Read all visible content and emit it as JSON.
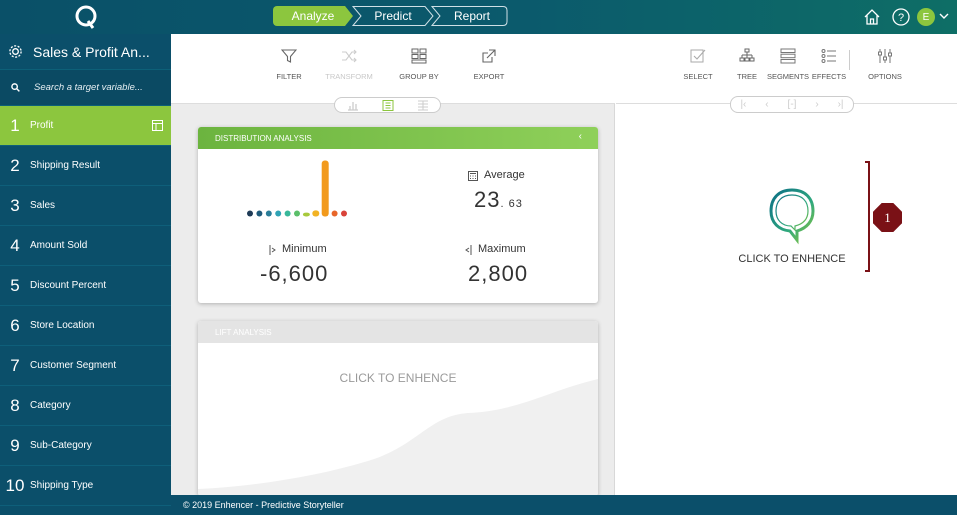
{
  "header": {
    "steps": [
      "Analyze",
      "Predict",
      "Report"
    ],
    "user_initial": "E"
  },
  "sidebar": {
    "title": "Sales & Profit An...",
    "search_placeholder": "Search a target variable...",
    "items": [
      {
        "num": "1",
        "label": "Profit"
      },
      {
        "num": "2",
        "label": "Shipping Result"
      },
      {
        "num": "3",
        "label": "Sales"
      },
      {
        "num": "4",
        "label": "Amount Sold"
      },
      {
        "num": "5",
        "label": "Discount Percent"
      },
      {
        "num": "6",
        "label": "Store Location"
      },
      {
        "num": "7",
        "label": "Customer Segment"
      },
      {
        "num": "8",
        "label": "Category"
      },
      {
        "num": "9",
        "label": "Sub-Category"
      },
      {
        "num": "10",
        "label": "Shipping Type"
      }
    ]
  },
  "toolbar": {
    "filter": "FILTER",
    "transform": "TRANSFORM",
    "group_by": "GROUP BY",
    "export": "EXPORT"
  },
  "right_toolbar": {
    "select": "SELECT",
    "tree": "TREE",
    "segments": "SEGMENTS",
    "effects": "EFFECTS",
    "options": "OPTIONS"
  },
  "distribution": {
    "title": "DISTRIBUTION ANALYSIS",
    "average_label": "Average",
    "average_int": "23",
    "average_dec": ". 63",
    "minimum_label": "Minimum",
    "minimum_value": "-6,600",
    "maximum_label": "Maximum",
    "maximum_value": "2,800",
    "bars": [
      {
        "value": 0.04,
        "color": "#1f3b57"
      },
      {
        "value": 0.04,
        "color": "#1f5a7a"
      },
      {
        "value": 0.04,
        "color": "#2a7d98"
      },
      {
        "value": 0.04,
        "color": "#2fa3b5"
      },
      {
        "value": 0.04,
        "color": "#38b89a"
      },
      {
        "value": 0.04,
        "color": "#5bbf6a"
      },
      {
        "value": 0.07,
        "color": "#a8c93c"
      },
      {
        "value": 0.11,
        "color": "#f2b325"
      },
      {
        "value": 1.0,
        "color": "#f29a1d"
      },
      {
        "value": 0.04,
        "color": "#e8662a"
      },
      {
        "value": 0.04,
        "color": "#d9433a"
      }
    ]
  },
  "lift": {
    "title": "LIFT ANALYSIS",
    "cta": "CLICK TO ENHENCE"
  },
  "right": {
    "cta": "CLICK TO ENHENCE",
    "badge": "1"
  },
  "footer": {
    "text": "© 2019 Enhencer -   Predictive Storyteller"
  },
  "colors": {
    "brand_dark": "#0b4f6a",
    "accent_green": "#8cc63e",
    "annotation": "#7a1116"
  }
}
